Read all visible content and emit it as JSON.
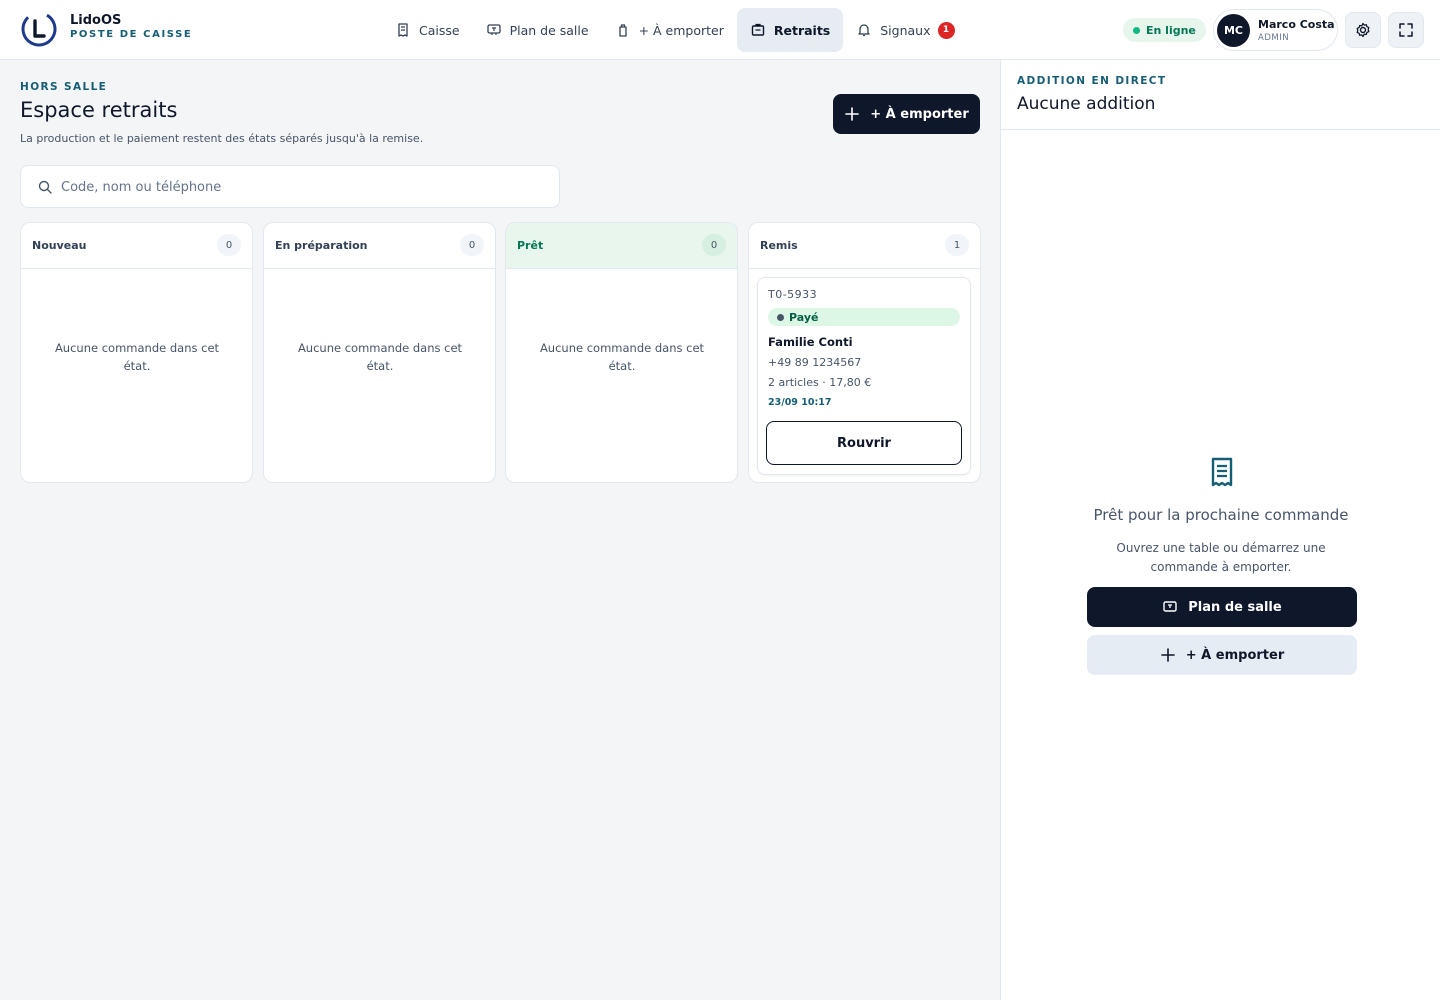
{
  "brand": {
    "name": "LidoOS",
    "subtitle": "POSTE DE CAISSE"
  },
  "nav": [
    {
      "label": "Caisse",
      "icon": "receipt-icon"
    },
    {
      "label": "Plan de salle",
      "icon": "floorplan-icon"
    },
    {
      "label": "+ À emporter",
      "icon": "bag-icon"
    },
    {
      "label": "Retraits",
      "icon": "pickup-icon",
      "active": true
    },
    {
      "label": "Signaux",
      "icon": "bell-icon",
      "badge": "1"
    }
  ],
  "status": {
    "label": "En ligne",
    "color": "#10b981"
  },
  "user": {
    "initials": "MC",
    "name": "Marco Costa",
    "role": "ADMIN"
  },
  "page": {
    "eyebrow": "HORS SALLE",
    "title": "Espace retraits",
    "description": "La production et le paiement restent des états séparés jusqu'à la remise.",
    "new_takeaway_label": "+ À emporter"
  },
  "search": {
    "placeholder": "Code, nom ou téléphone",
    "value": ""
  },
  "columns": [
    {
      "title": "Nouveau",
      "count": "0",
      "empty": "Aucune commande dans cet état."
    },
    {
      "title": "En préparation",
      "count": "0",
      "empty": "Aucune commande dans cet état."
    },
    {
      "title": "Prêt",
      "count": "0",
      "empty": "Aucune commande dans cet état."
    },
    {
      "title": "Remis",
      "count": "1"
    }
  ],
  "order": {
    "code": "T0-5933",
    "payment_status": "Payé",
    "customer": "Familie Conti",
    "phone": "+49 89 1234567",
    "summary": "2 articles · 17,80 €",
    "time": "23/09 10:17",
    "reopen_label": "Rouvrir"
  },
  "live_bill": {
    "eyebrow": "ADDITION EN DIRECT",
    "title": "Aucune addition",
    "ready_title": "Prêt pour la prochaine commande",
    "ready_desc": "Ouvrez une table ou démarrez une commande à emporter.",
    "floorplan_label": "Plan de salle",
    "takeaway_label": "+ À emporter"
  },
  "colors": {
    "primary": "#0f172a",
    "accent": "#155e75",
    "ready_bg": "#e9f6ee",
    "paid_bg": "#dcf7e6",
    "alert": "#dc2626"
  }
}
